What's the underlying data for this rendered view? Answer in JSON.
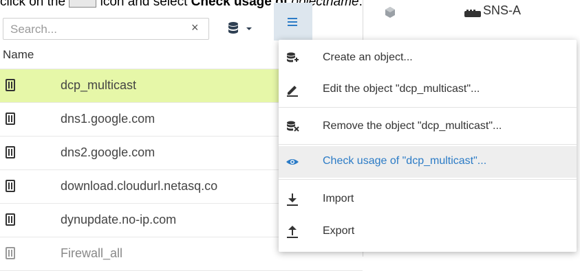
{
  "caption": {
    "prefix": "click on the",
    "middle": "icon and select",
    "bold": "Check usage of",
    "italic": "objectname",
    "suffix": "."
  },
  "toolbar": {
    "search_placeholder": "Search...",
    "clear_glyph": "×",
    "db_icon": "database-icon",
    "menu_icon": "hamburger-icon"
  },
  "right_panel": {
    "label": "SNS-A"
  },
  "list": {
    "header": "Name",
    "rows": [
      {
        "name": "dcp_multicast"
      },
      {
        "name": "dns1.google.com"
      },
      {
        "name": "dns2.google.com"
      },
      {
        "name": "download.cloudurl.netasq.co"
      },
      {
        "name": "dynupdate.no-ip.com"
      },
      {
        "name": "Firewall_all"
      }
    ]
  },
  "menu": {
    "items": [
      {
        "label": "Create an object...",
        "icon": "database-add-icon"
      },
      {
        "label": "Edit the object \"dcp_multicast\"...",
        "icon": "pencil-icon"
      },
      {
        "label": "Remove the object \"dcp_multicast\"...",
        "icon": "database-remove-icon"
      },
      {
        "label": "Check usage of \"dcp_multicast\"...",
        "icon": "eye-icon"
      },
      {
        "label": "Import",
        "icon": "download-icon"
      },
      {
        "label": "Export",
        "icon": "upload-icon"
      }
    ]
  },
  "colors": {
    "selected_row": "#e6f7a8",
    "menu_highlight_text": "#2b7bc6",
    "menu_button_bg": "#dde6ee",
    "icon_dark": "#333333"
  }
}
